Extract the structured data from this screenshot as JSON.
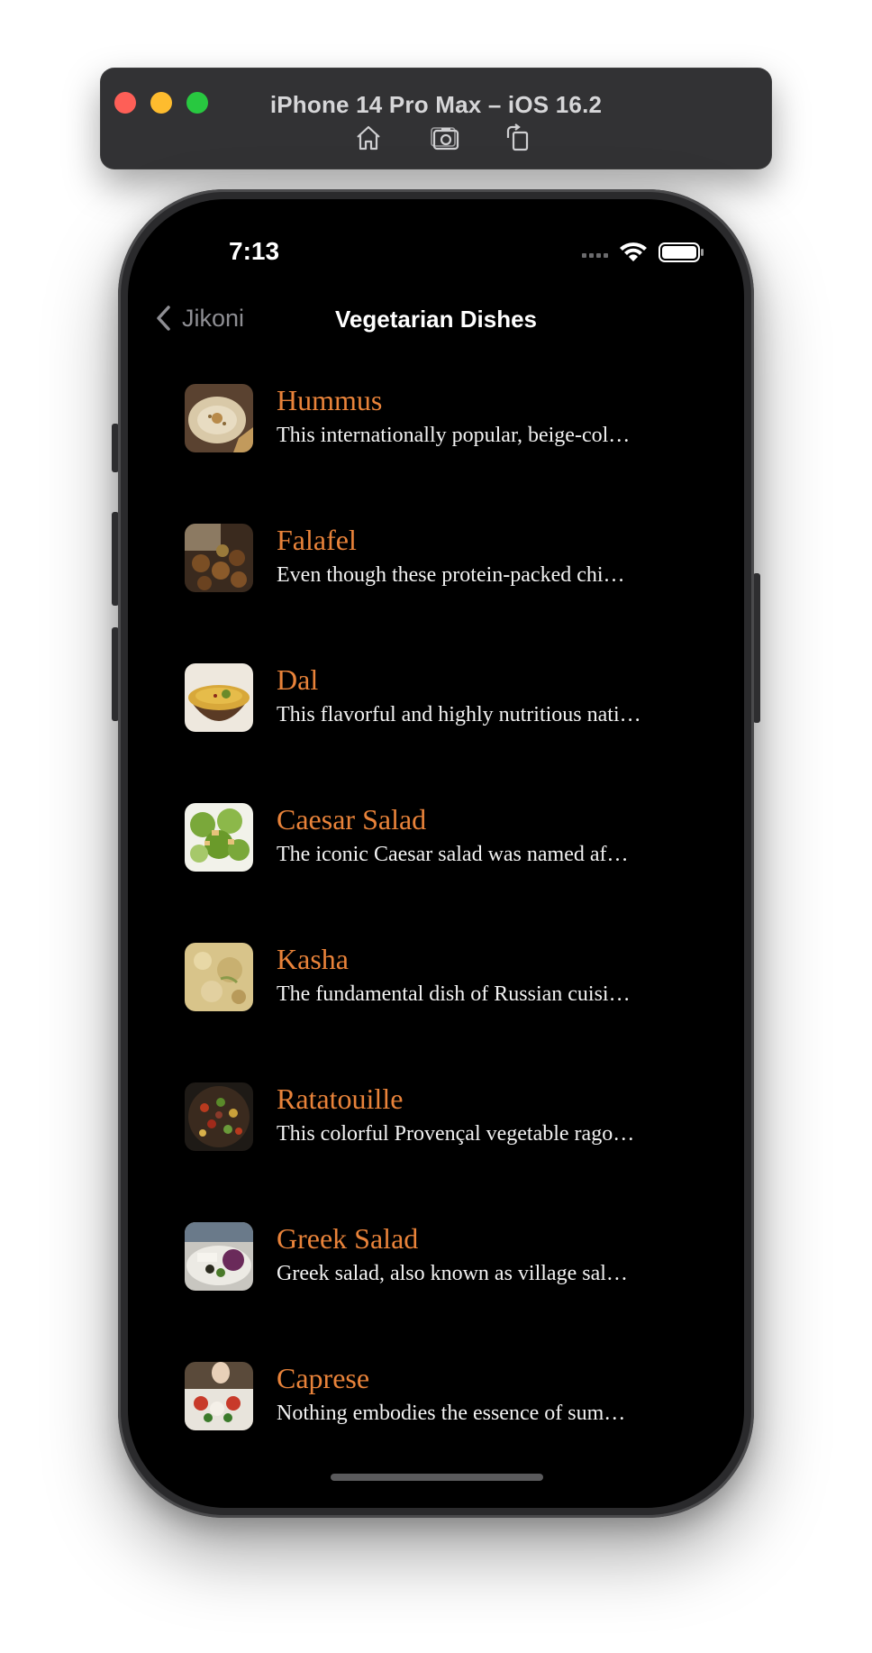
{
  "simulator": {
    "title": "iPhone 14 Pro Max – iOS 16.2",
    "tools": [
      "home-icon",
      "screenshot-icon",
      "rotate-icon"
    ]
  },
  "status_bar": {
    "time": "7:13"
  },
  "nav": {
    "back_label": "Jikoni",
    "title": "Vegetarian Dishes"
  },
  "colors": {
    "accent": "#e9833a",
    "background": "#000000"
  },
  "dishes": [
    {
      "name": "Hummus",
      "desc": "This internationally popular, beige-col…"
    },
    {
      "name": "Falafel",
      "desc": "Even though these protein-packed chi…"
    },
    {
      "name": "Dal",
      "desc": "This flavorful and highly nutritious nati…"
    },
    {
      "name": "Caesar Salad",
      "desc": "The iconic Caesar salad was named af…"
    },
    {
      "name": "Kasha",
      "desc": "The fundamental dish of Russian cuisi…"
    },
    {
      "name": "Ratatouille",
      "desc": "This colorful Provençal vegetable rago…"
    },
    {
      "name": "Greek Salad",
      "desc": "Greek salad, also known as village sal…"
    },
    {
      "name": "Caprese",
      "desc": "Nothing embodies the essence of sum…"
    }
  ]
}
